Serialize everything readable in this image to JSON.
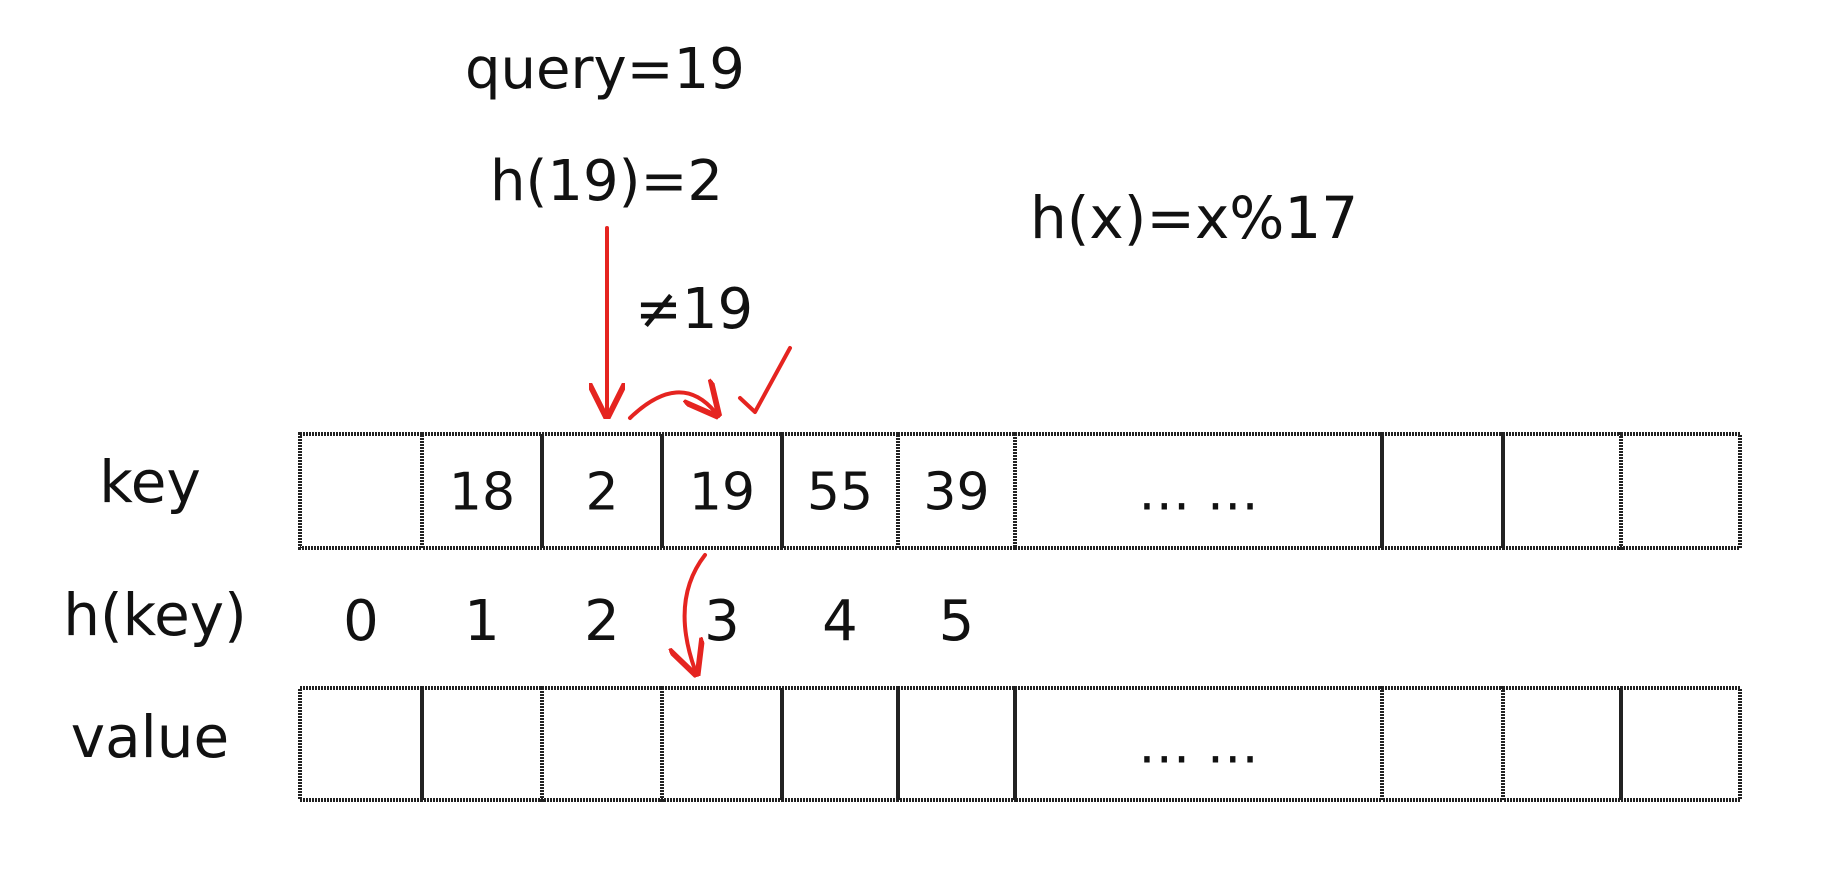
{
  "annotations": {
    "query": "query=19",
    "hash_of_query": "h(19)=2",
    "hash_function": "h(x)=x%17",
    "not_equal": "≠19"
  },
  "row_labels": {
    "key": "key",
    "hash": "h(key)",
    "value": "value"
  },
  "key_cells": [
    "",
    "18",
    "2",
    "19",
    "55",
    "39",
    "… …",
    "",
    "",
    ""
  ],
  "hash_indices": [
    "0",
    "1",
    "2",
    "3",
    "4",
    "5"
  ],
  "value_cells": [
    "",
    "",
    "",
    "",
    "",
    "",
    "… …",
    "",
    "",
    ""
  ],
  "colors": {
    "accent": "#e52420",
    "ink": "#111111",
    "grid": "#222222"
  }
}
